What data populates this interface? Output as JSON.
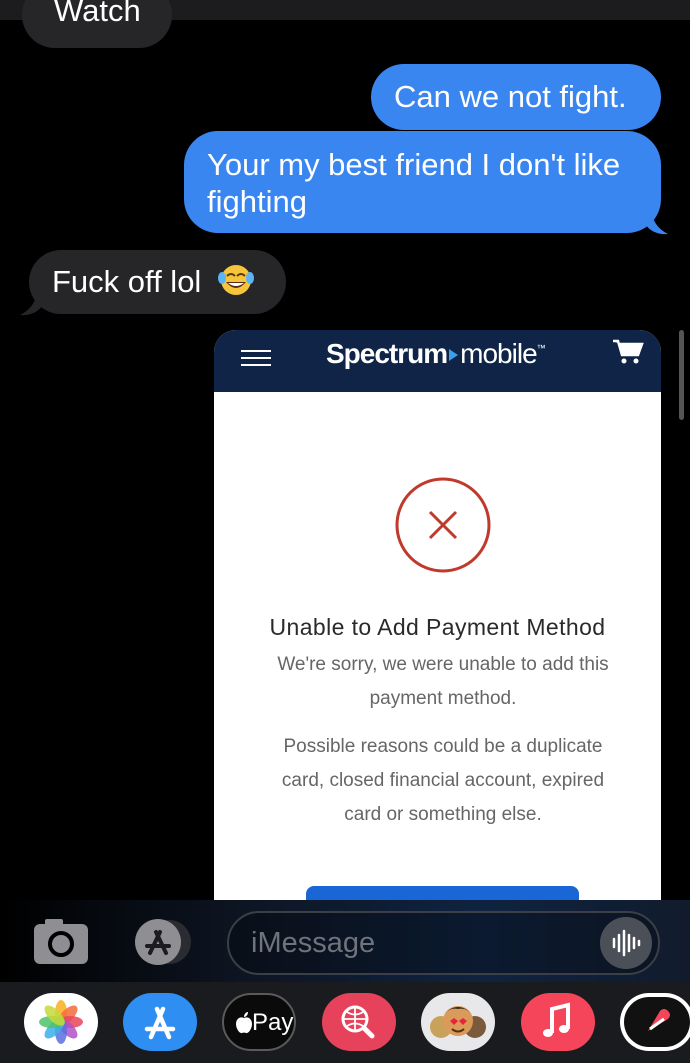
{
  "conversation": {
    "messages": [
      {
        "direction": "incoming",
        "text": "Watch"
      },
      {
        "direction": "outgoing",
        "text": "Can we not fight."
      },
      {
        "direction": "outgoing",
        "text": "Your my best friend I don't like fighting"
      },
      {
        "direction": "incoming",
        "text": "Fuck off lol"
      }
    ]
  },
  "screenshot": {
    "brand_bold": "Spectrum",
    "brand_light": "mobile",
    "brand_tm": "™",
    "error_title": "Unable to Add Payment Method",
    "error_message": "We're sorry, we were unable to add this payment method.",
    "error_reasons": "Possible reasons could be a duplicate card, closed financial account, expired card or something else."
  },
  "composer": {
    "placeholder": "iMessage"
  },
  "app_drawer": {
    "apps": [
      "photos-app",
      "app-store",
      "apple-pay",
      "images-search",
      "memoji-stickers",
      "music",
      "digital-touch"
    ],
    "pay_label": "Pay"
  },
  "colors": {
    "outgoing_bubble": "#3a86f0",
    "incoming_bubble": "#262629",
    "spectrum_header": "#0f2446",
    "error_red": "#c0392b"
  }
}
